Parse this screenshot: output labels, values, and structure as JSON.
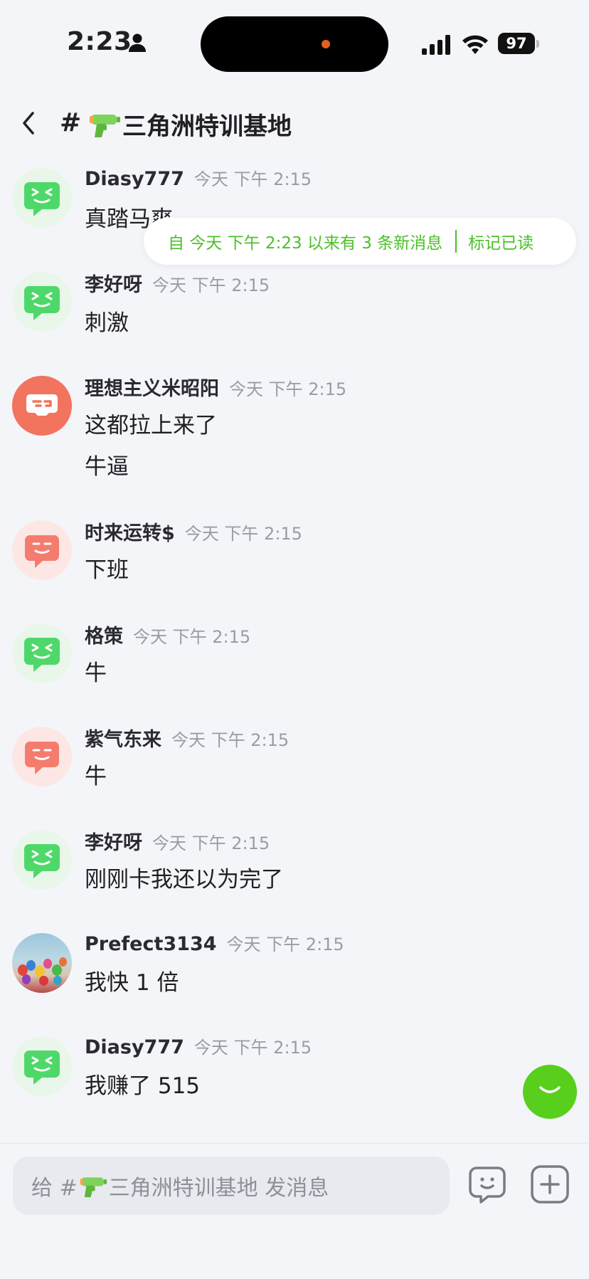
{
  "status_bar": {
    "time": "2:23",
    "battery": "97"
  },
  "header": {
    "hash": "#",
    "channel_name": "三角洲特训基地"
  },
  "banner": {
    "text": "自 今天 下午 2:23 以来有 3 条新消息",
    "action": "标记已读"
  },
  "messages": [
    {
      "name": "Diasy777",
      "time": "今天 下午 2:15",
      "texts": [
        "真踏马爽"
      ],
      "avatar": "green-bot-avatar"
    },
    {
      "name": "李好呀",
      "time": "今天 下午 2:15",
      "texts": [
        "刺激"
      ],
      "avatar": "green-bot-avatar"
    },
    {
      "name": "理想主义米昭阳",
      "time": "今天 下午 2:15",
      "texts": [
        "这都拉上来了",
        "牛逼"
      ],
      "avatar": "red-gamepad-avatar"
    },
    {
      "name": "时来运转$",
      "time": "今天 下午 2:15",
      "texts": [
        "下班"
      ],
      "avatar": "pink-bot-avatar"
    },
    {
      "name": "格策",
      "time": "今天 下午 2:15",
      "texts": [
        "牛"
      ],
      "avatar": "green-bot-avatar"
    },
    {
      "name": "紫气东来",
      "time": "今天 下午 2:15",
      "texts": [
        "牛"
      ],
      "avatar": "pink-bot-avatar"
    },
    {
      "name": "李好呀",
      "time": "今天 下午 2:15",
      "texts": [
        "刚刚卡我还以为完了"
      ],
      "avatar": "green-bot-avatar"
    },
    {
      "name": "Prefect3134",
      "time": "今天 下午 2:15",
      "texts": [
        "我快 1 倍"
      ],
      "avatar": "balloon-photo-avatar"
    },
    {
      "name": "Diasy777",
      "time": "今天 下午 2:15",
      "texts": [
        "我赚了 515"
      ],
      "avatar": "green-bot-avatar"
    }
  ],
  "composer": {
    "placeholder_prefix": "给 #",
    "placeholder_channel": "三角洲特训基地",
    "placeholder_suffix": " 发消息"
  },
  "colors": {
    "accent": "#57cf1c",
    "banner_text": "#4cc02a",
    "green_avatar": "#4fd86a",
    "pink_avatar": "#f47c6f",
    "red_avatar": "#f2735e"
  }
}
